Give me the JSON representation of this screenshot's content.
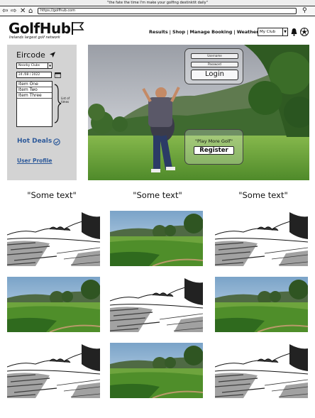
{
  "browser": {
    "title": "\"the fate the time I'm make your golfing destinktit daily\"",
    "url": "https://golfhub.com"
  },
  "header": {
    "logo": "GolfHub",
    "tagline": "Irelands largest golf network",
    "nav": [
      "Results",
      "Shop",
      "Manage Booking",
      "Weather"
    ],
    "club_select": "My Club"
  },
  "sidebar": {
    "eircode_label": "Eircode",
    "nearby_select": "Nearby Clubs",
    "date_value": "24 /08 /  2022",
    "list_items": [
      "Item One",
      "Item Two",
      "Item Three"
    ],
    "list_note": "List of times",
    "hot_deals": "Hot Deals",
    "user_profile": "User Profile"
  },
  "login": {
    "username_placeholder": "Username",
    "password_placeholder": "Password",
    "login_label": "Login"
  },
  "register": {
    "prompt": "\"Play More Golf\"",
    "register_label": "Register"
  },
  "content": {
    "headings": [
      "\"Some text\"",
      "\"Some text\"",
      "\"Some text\""
    ]
  },
  "colors": {
    "sidebar_bg": "#d3d3d3",
    "link_blue": "#2e5a9a"
  }
}
